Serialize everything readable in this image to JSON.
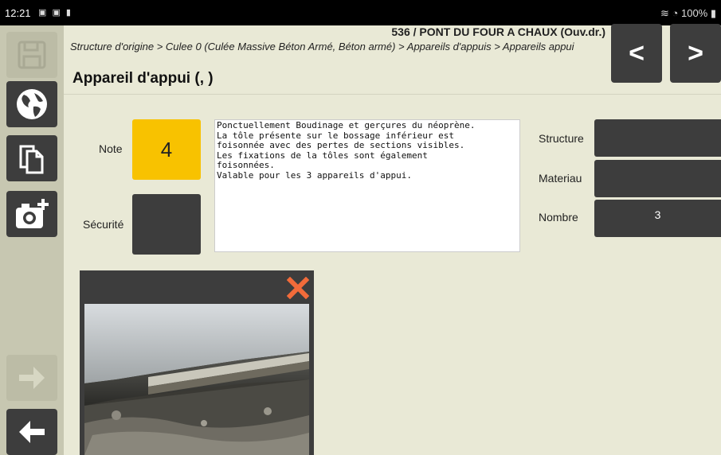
{
  "status_bar": {
    "time": "12:21",
    "battery": "100%"
  },
  "header": {
    "code_title": "536 / PONT DU FOUR A CHAUX (Ouv.dr.)",
    "breadcrumb": "Structure d'origine > Culee 0 (Culée Massive Béton Armé, Béton armé) > Appareils d'appuis > Appareils appui",
    "title": "Appareil d'appui (, )",
    "prev_label": "<",
    "next_label": ">"
  },
  "sidebar": {
    "icons": [
      "save-icon",
      "globe-icon",
      "copy-icon",
      "add-photo-icon",
      "forward-arrow-icon",
      "back-arrow-icon"
    ]
  },
  "form": {
    "note_label": "Note",
    "note_value": "4",
    "note_color": "#f8c200",
    "securite_label": "Sécurité",
    "comment": "Ponctuellement Boudinage et gerçures du néoprène.\nLa tôle présente sur le bossage inférieur est\nfoisonnée avec des pertes de sections visibles.\nLes fixations de la tôles sont également\nfoisonnées.\nValable pour les 3 appareils d'appui.",
    "structure_label": "Structure",
    "structure_value": "",
    "materiau_label": "Materiau",
    "materiau_value": "",
    "nombre_label": "Nombre",
    "nombre_value": "3"
  },
  "photo": {
    "close_icon": "close-icon",
    "close_color": "#f26b3a"
  }
}
